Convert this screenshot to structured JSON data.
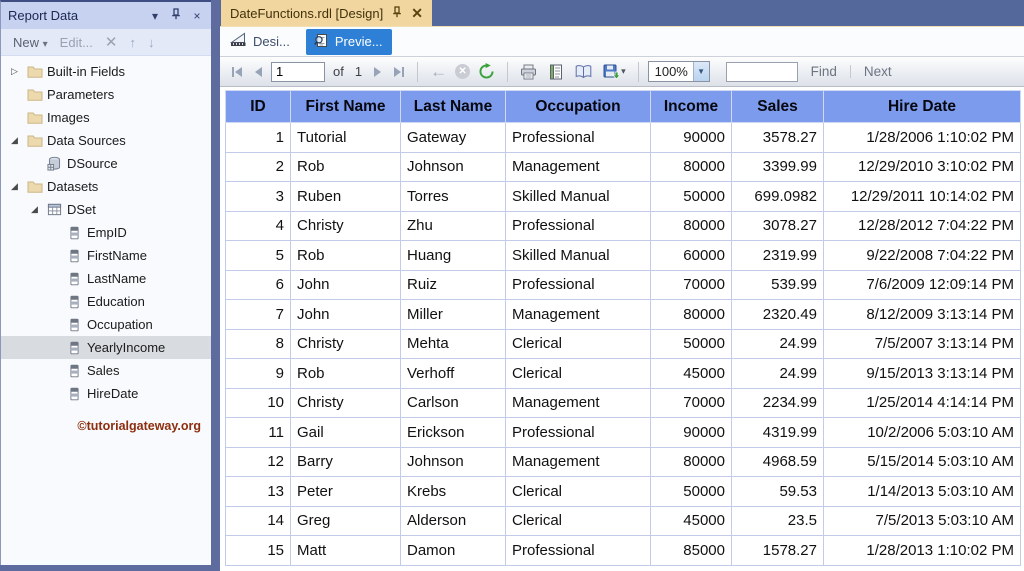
{
  "colors": {
    "header_blue": "#7d9bec",
    "preview_blue": "#2e7fd6",
    "active_doc_tab": "#f2d6a0",
    "tabstrip_bg": "#55689b",
    "splitter": "#5d6b9e",
    "sidebar_title_bg": "#c6d2f0",
    "selection": "#d8dbe0",
    "watermark": "#8d2e0e"
  },
  "sidebar": {
    "title": "Report Data",
    "toolbar": {
      "new_label": "New",
      "edit_label": "Edit...",
      "delete_icon": "✕",
      "up_icon": "↑",
      "down_icon": "↓"
    },
    "tree": [
      {
        "label": "Built-in Fields",
        "icon": "folder",
        "level": 0,
        "expander": "collapsed",
        "selected": false
      },
      {
        "label": "Parameters",
        "icon": "folder",
        "level": 0,
        "expander": "none",
        "selected": false
      },
      {
        "label": "Images",
        "icon": "folder",
        "level": 0,
        "expander": "none",
        "selected": false
      },
      {
        "label": "Data Sources",
        "icon": "folder",
        "level": 0,
        "expander": "expanded",
        "selected": false
      },
      {
        "label": "DSource",
        "icon": "database",
        "level": 1,
        "expander": "none",
        "selected": false
      },
      {
        "label": "Datasets",
        "icon": "folder",
        "level": 0,
        "expander": "expanded",
        "selected": false
      },
      {
        "label": "DSet",
        "icon": "dataset",
        "level": 1,
        "expander": "expanded",
        "selected": false
      },
      {
        "label": "EmpID",
        "icon": "field",
        "level": 2,
        "expander": "none",
        "selected": false
      },
      {
        "label": "FirstName",
        "icon": "field",
        "level": 2,
        "expander": "none",
        "selected": false
      },
      {
        "label": "LastName",
        "icon": "field",
        "level": 2,
        "expander": "none",
        "selected": false
      },
      {
        "label": "Education",
        "icon": "field",
        "level": 2,
        "expander": "none",
        "selected": false
      },
      {
        "label": "Occupation",
        "icon": "field",
        "level": 2,
        "expander": "none",
        "selected": false
      },
      {
        "label": "YearlyIncome",
        "icon": "field",
        "level": 2,
        "expander": "none",
        "selected": true
      },
      {
        "label": "Sales",
        "icon": "field",
        "level": 2,
        "expander": "none",
        "selected": false
      },
      {
        "label": "HireDate",
        "icon": "field",
        "level": 2,
        "expander": "none",
        "selected": false
      }
    ],
    "watermark": "©tutorialgateway.org"
  },
  "document_tab": {
    "title": "DateFunctions.rdl [Design]",
    "close_icon": "✕"
  },
  "view_tabs": {
    "design_label": "Desi...",
    "preview_label": "Previe..."
  },
  "report_toolbar": {
    "page_number": "1",
    "of_label": "of",
    "page_count": "1",
    "zoom_value": "100%",
    "find_label": "Find",
    "next_label": "Next",
    "find_value": ""
  },
  "table": {
    "columns": [
      {
        "label": "ID",
        "align": "right"
      },
      {
        "label": "First Name",
        "align": "left"
      },
      {
        "label": "Last Name",
        "align": "left"
      },
      {
        "label": "Occupation",
        "align": "left"
      },
      {
        "label": "Income",
        "align": "right"
      },
      {
        "label": "Sales",
        "align": "right"
      },
      {
        "label": "Hire Date",
        "align": "right"
      }
    ],
    "rows": [
      [
        "1",
        "Tutorial",
        "Gateway",
        "Professional",
        "90000",
        "3578.27",
        "1/28/2006 1:10:02 PM"
      ],
      [
        "2",
        "Rob",
        "Johnson",
        "Management",
        "80000",
        "3399.99",
        "12/29/2010 3:10:02 PM"
      ],
      [
        "3",
        "Ruben",
        "Torres",
        "Skilled Manual",
        "50000",
        "699.0982",
        "12/29/2011 10:14:02 PM"
      ],
      [
        "4",
        "Christy",
        "Zhu",
        "Professional",
        "80000",
        "3078.27",
        "12/28/2012 7:04:22 PM"
      ],
      [
        "5",
        "Rob",
        "Huang",
        "Skilled Manual",
        "60000",
        "2319.99",
        "9/22/2008 7:04:22 PM"
      ],
      [
        "6",
        "John",
        "Ruiz",
        "Professional",
        "70000",
        "539.99",
        "7/6/2009 12:09:14 PM"
      ],
      [
        "7",
        "John",
        "Miller",
        "Management",
        "80000",
        "2320.49",
        "8/12/2009 3:13:14 PM"
      ],
      [
        "8",
        "Christy",
        "Mehta",
        "Clerical",
        "50000",
        "24.99",
        "7/5/2007 3:13:14 PM"
      ],
      [
        "9",
        "Rob",
        "Verhoff",
        "Clerical",
        "45000",
        "24.99",
        "9/15/2013 3:13:14 PM"
      ],
      [
        "10",
        "Christy",
        "Carlson",
        "Management",
        "70000",
        "2234.99",
        "1/25/2014 4:14:14 PM"
      ],
      [
        "11",
        "Gail",
        "Erickson",
        "Professional",
        "90000",
        "4319.99",
        "10/2/2006 5:03:10 AM"
      ],
      [
        "12",
        "Barry",
        "Johnson",
        "Management",
        "80000",
        "4968.59",
        "5/15/2014 5:03:10 AM"
      ],
      [
        "13",
        "Peter",
        "Krebs",
        "Clerical",
        "50000",
        "59.53",
        "1/14/2013 5:03:10 AM"
      ],
      [
        "14",
        "Greg",
        "Alderson",
        "Clerical",
        "45000",
        "23.5",
        "7/5/2013 5:03:10 AM"
      ],
      [
        "15",
        "Matt",
        "Damon",
        "Professional",
        "85000",
        "1578.27",
        "1/28/2013 1:10:02 PM"
      ]
    ]
  }
}
